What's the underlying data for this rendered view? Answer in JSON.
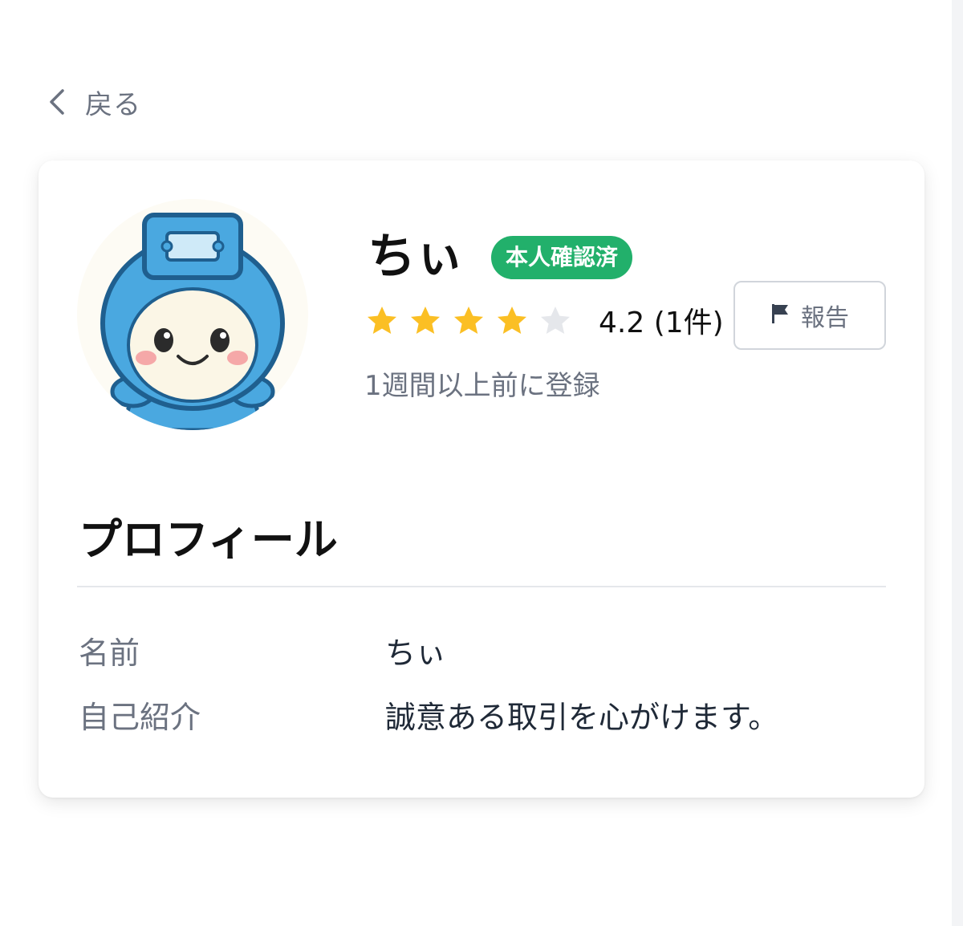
{
  "nav": {
    "back_label": "戻る"
  },
  "profile": {
    "name": "ちぃ",
    "verified_badge": "本人確認済",
    "rating": 4.2,
    "rating_max": 5,
    "rating_text": "4.2 (1件)",
    "joined_text": "1週間以上前に登録",
    "report_label": "報告",
    "avatar_icon": "mascot-avatar-icon"
  },
  "section": {
    "title": "プロフィール",
    "fields": [
      {
        "label": "名前",
        "value": "ちぃ"
      },
      {
        "label": "自己紹介",
        "value": "誠意ある取引を心がけます。"
      }
    ]
  },
  "colors": {
    "badge_green": "#22b06b",
    "star_filled": "#fbbf24",
    "star_empty": "#e5e7eb",
    "muted_text": "#6b7280"
  }
}
